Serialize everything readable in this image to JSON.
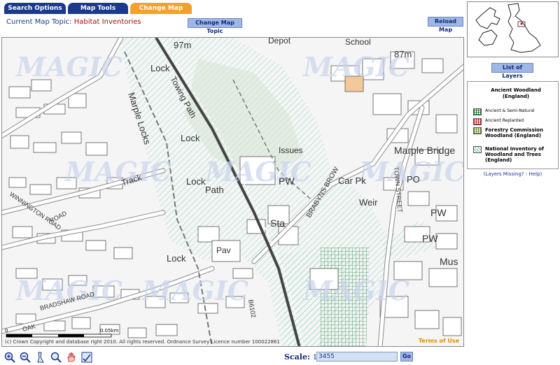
{
  "tabs": [
    {
      "label": "Search Options"
    },
    {
      "label": "Map Tools"
    },
    {
      "label": "Change Map Topic"
    }
  ],
  "topic": {
    "label": "Current Map Topic:",
    "value": "Habitat Inventories"
  },
  "buttons": {
    "change_topic": "Change Map Topic",
    "reload_map": "Reload Map",
    "list_layers": "List of Layers",
    "go": "Go"
  },
  "map": {
    "labels": [
      "97m",
      "Depot",
      "School",
      "87m",
      "Lock",
      "Towing Path",
      "Marple Locks",
      "Lock",
      "Issues",
      "Marple Bridge",
      "Lock",
      "Path",
      "PW",
      "Car Pk",
      "Weir",
      "Track",
      "Sta",
      "Pav",
      "Lock",
      "PW",
      "PW",
      "PO",
      "Mus",
      "BRABYNS BROW",
      "TOWN STREET",
      "WINNINGTON ROAD",
      "ROAD",
      "BRADSHAW ROAD",
      "B6102",
      "OAK"
    ],
    "watermark": "MAGIC",
    "copyright": "(c) Crown Copyright and database right 2010. All rights reserved. Ordnance Survey Licence number 100022861",
    "terms": "Terms of Use",
    "scalebar": {
      "start": "0",
      "end": "0.05km"
    }
  },
  "legend": {
    "heading": "Ancient Woodland (England)",
    "items": [
      {
        "label": "Ancient & Semi-Natural",
        "color": "#2e7d32"
      },
      {
        "label": "Ancient Replanted",
        "color": "#c62828"
      },
      {
        "label": "Forestry Commission Woodland (England)",
        "color": "#6d8f3a"
      },
      {
        "label": "National Inventory of Woodland and Trees (England)",
        "color": "#5fc9a0"
      }
    ],
    "missing": "(Layers Missing? - Help)"
  },
  "scale": {
    "label": "Scale:",
    "prefix": "1:",
    "value": "3455"
  },
  "tools": [
    "zoom-in-icon",
    "zoom-out-icon",
    "measure-icon",
    "zoom-extent-icon",
    "pan-hand-icon",
    "os-grid-icon"
  ]
}
